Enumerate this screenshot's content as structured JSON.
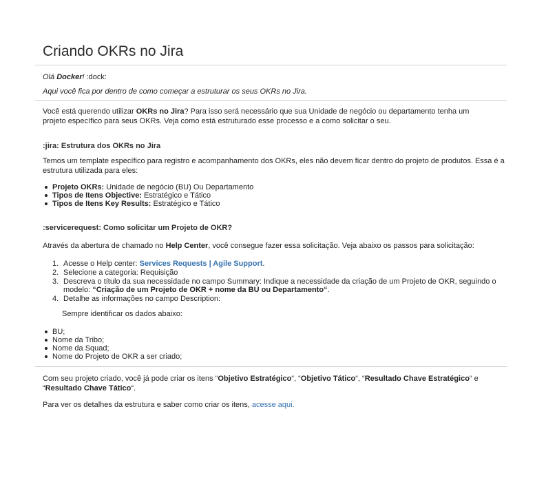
{
  "page": {
    "title": "Criando OKRs no Jira",
    "greeting": {
      "prefix": "Olá ",
      "name": "Docker",
      "suffix": "! ",
      "emoji": ":dock:"
    },
    "subtitle": "Aqui você fica por dentro de como começar a estruturar os seus OKRs no Jira.",
    "intro": {
      "pre": "Você está querendo utilizar ",
      "bold": "OKRs no Jira",
      "post": "? Para isso será necessário que sua Unidade de negócio ou departamento tenha um projeto específico para seus OKRs. Veja como está estruturado esse processo e a como solicitar o seu."
    },
    "section1": {
      "heading": ":jira: Estrutura dos OKRs no Jira",
      "text": "Temos um template específico para registro e acompanhamento dos OKRs, eles não devem ficar dentro do projeto de produtos. Essa é a estrutura utilizada para eles:",
      "items": [
        {
          "label": "Projeto OKRs:",
          "value": " Unidade de negócio (BU) Ou Departamento"
        },
        {
          "label": "Tipos de Itens Objective:",
          "value": " Estratégico e Tático"
        },
        {
          "label": "Tipos de Itens Key Results:",
          "value": " Estratégico e Tático"
        }
      ]
    },
    "section2": {
      "heading": ":servicerequest: Como solicitar um Projeto de OKR?",
      "text_pre": "Através da abertura de chamado no ",
      "text_bold": "Help Center",
      "text_post": ", você consegue fazer essa solicitação. Veja abaixo os passos para solicitação:",
      "steps": [
        {
          "num": "1.",
          "pre": "Acesse o Help center: ",
          "link": "Services Requests | Agile Support",
          "post": "."
        },
        {
          "num": "2.",
          "text": "Selecione a categoria: Requisição"
        },
        {
          "num": "3.",
          "text": "Descreva o título da sua necessidade no campo Summary: Indique a necessidade da criação de um Projeto de OKR, seguindo o modelo: ",
          "bold": "“Criação de um Projeto de OKR + nome da BU ou Departamento“",
          "post": "."
        },
        {
          "num": "4.",
          "text": "Detalhe as informações no campo Description:"
        }
      ],
      "note": "Sempre identificar os dados abaixo:",
      "data_items": [
        "BU;",
        "Nome da Tribo;",
        "Nome da Squad;",
        "Nome do Projeto de OKR a ser criado;"
      ]
    },
    "closing": {
      "p1_a": "Com seu projeto criado, você já pode criar os itens “",
      "p1_b1": "Objetivo Estratégico",
      "p1_c": "“, “",
      "p1_b2": "Objetivo Tático",
      "p1_d": "“, “",
      "p1_b3": "Resultado Chave Estratégico",
      "p1_e": "“ e “",
      "p1_b4": "Resultado Chave Tático",
      "p1_f": "“.",
      "p2_pre": "Para ver os detalhes da estrutura e saber como criar os itens, ",
      "p2_link": "acesse aqui."
    }
  }
}
